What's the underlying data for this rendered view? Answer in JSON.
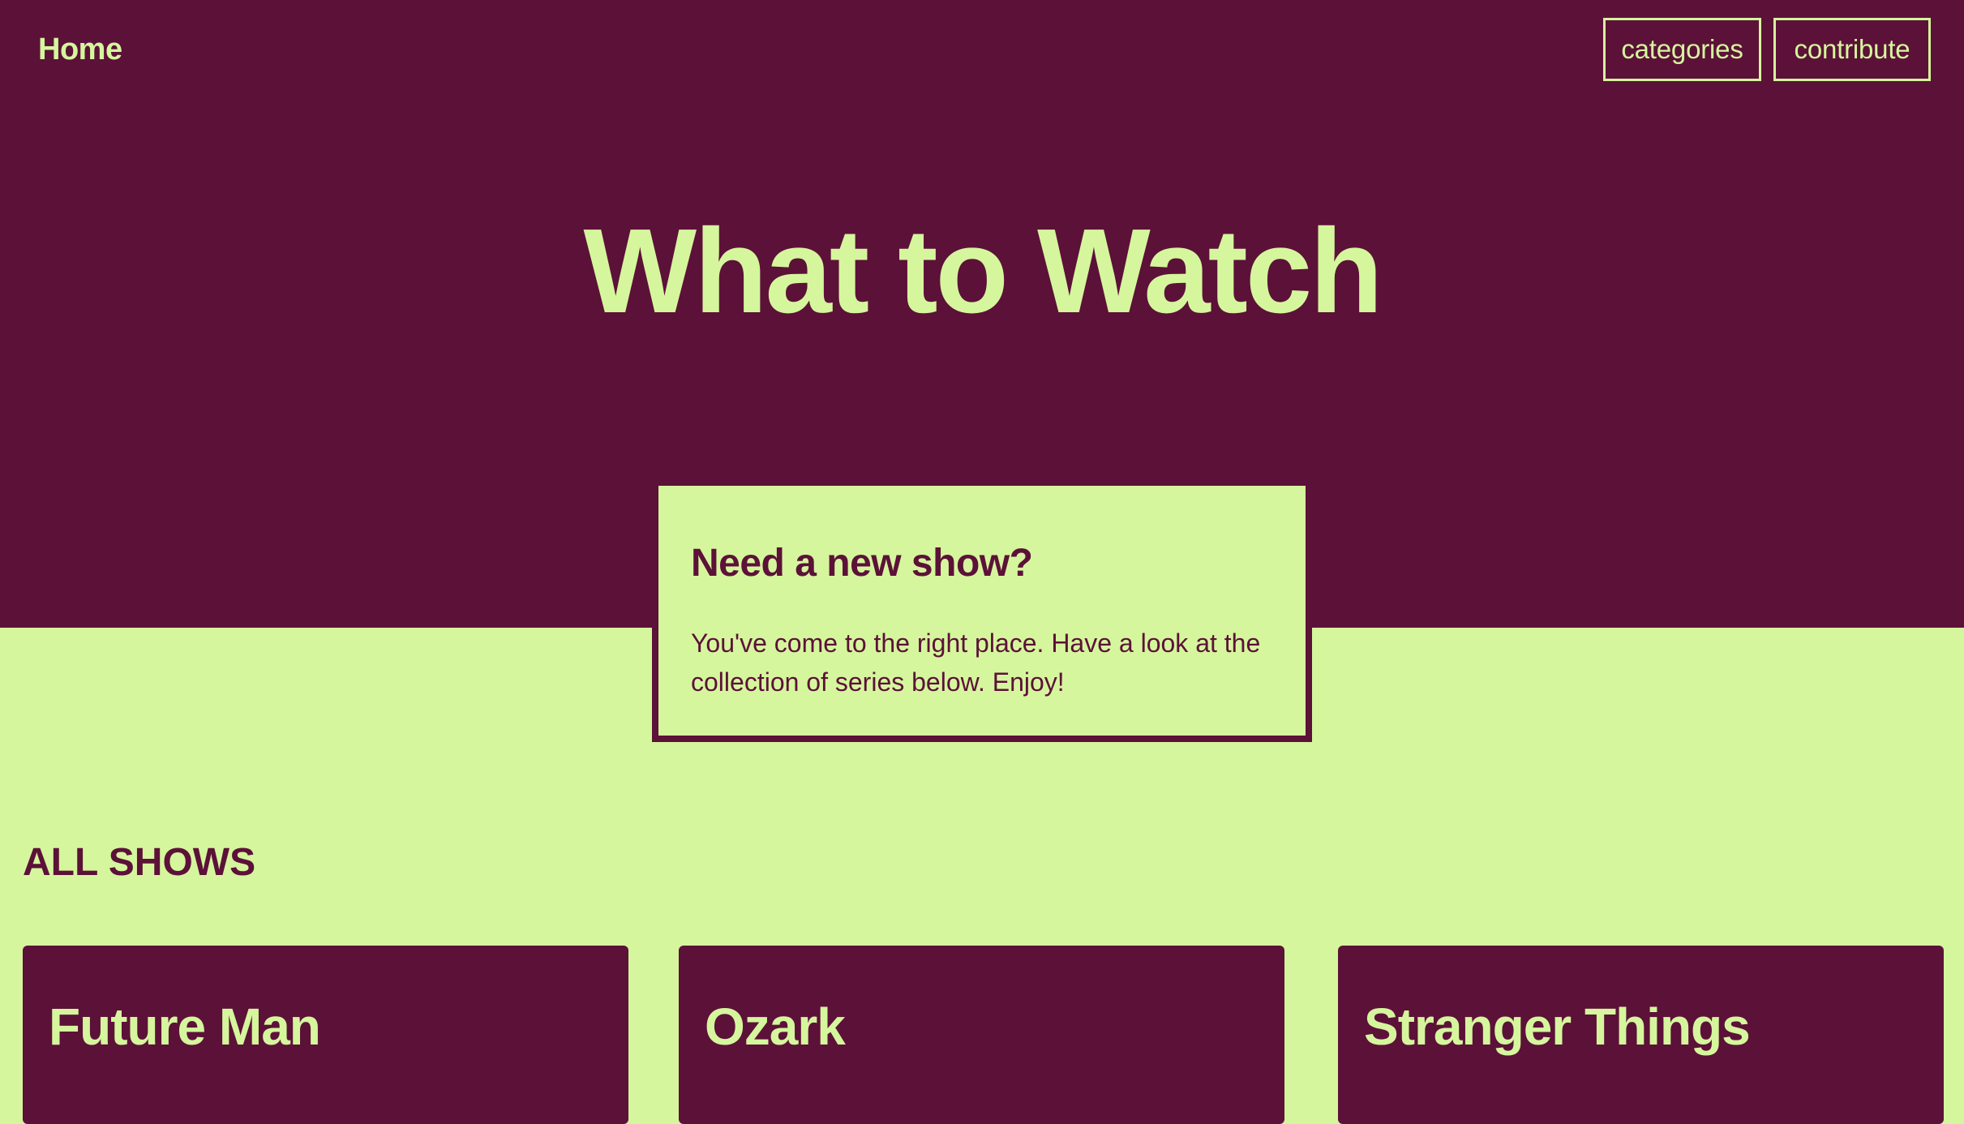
{
  "colors": {
    "primary": "#5c1138",
    "accent": "#d5f69d"
  },
  "header": {
    "home_label": "Home",
    "nav": {
      "categories_label": "categories",
      "contribute_label": "contribute"
    }
  },
  "hero": {
    "title": "What to Watch"
  },
  "intro": {
    "heading": "Need a new show?",
    "text": "You've come to the right place. Have a look at the collection of series below. Enjoy!"
  },
  "shows": {
    "section_title": "ALL SHOWS",
    "items": [
      {
        "title": "Future Man"
      },
      {
        "title": "Ozark"
      },
      {
        "title": "Stranger Things"
      }
    ]
  }
}
